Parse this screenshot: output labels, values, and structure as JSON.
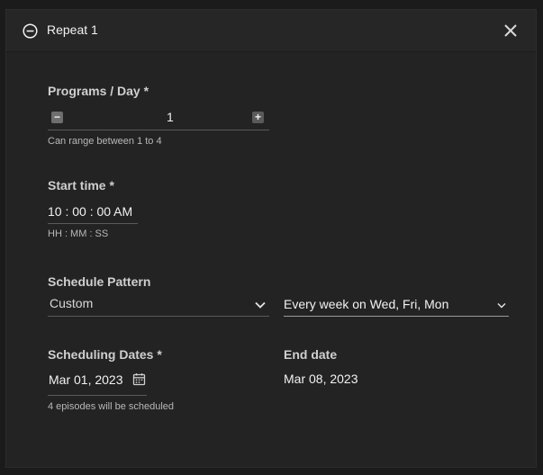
{
  "header": {
    "title": "Repeat 1"
  },
  "programs": {
    "label": "Programs / Day *",
    "value": "1",
    "minus": "−",
    "plus": "+",
    "hint": "Can range between 1 to 4"
  },
  "start_time": {
    "label": "Start time *",
    "value": "10 : 00 : 00 AM",
    "hint": "HH : MM : SS"
  },
  "schedule_pattern": {
    "label": "Schedule Pattern",
    "selected": "Custom",
    "recurrence": "Every week on Wed, Fri, Mon"
  },
  "scheduling_dates": {
    "label": "Scheduling Dates *",
    "start_value": "Mar 01, 2023",
    "hint": "4 episodes will be scheduled"
  },
  "end_date": {
    "label": "End date",
    "value": "Mar 08, 2023"
  },
  "colors": {
    "background": "#1b1b1b",
    "panel": "#232323",
    "text": "#f2f2f2",
    "muted": "#b8b8b8"
  }
}
